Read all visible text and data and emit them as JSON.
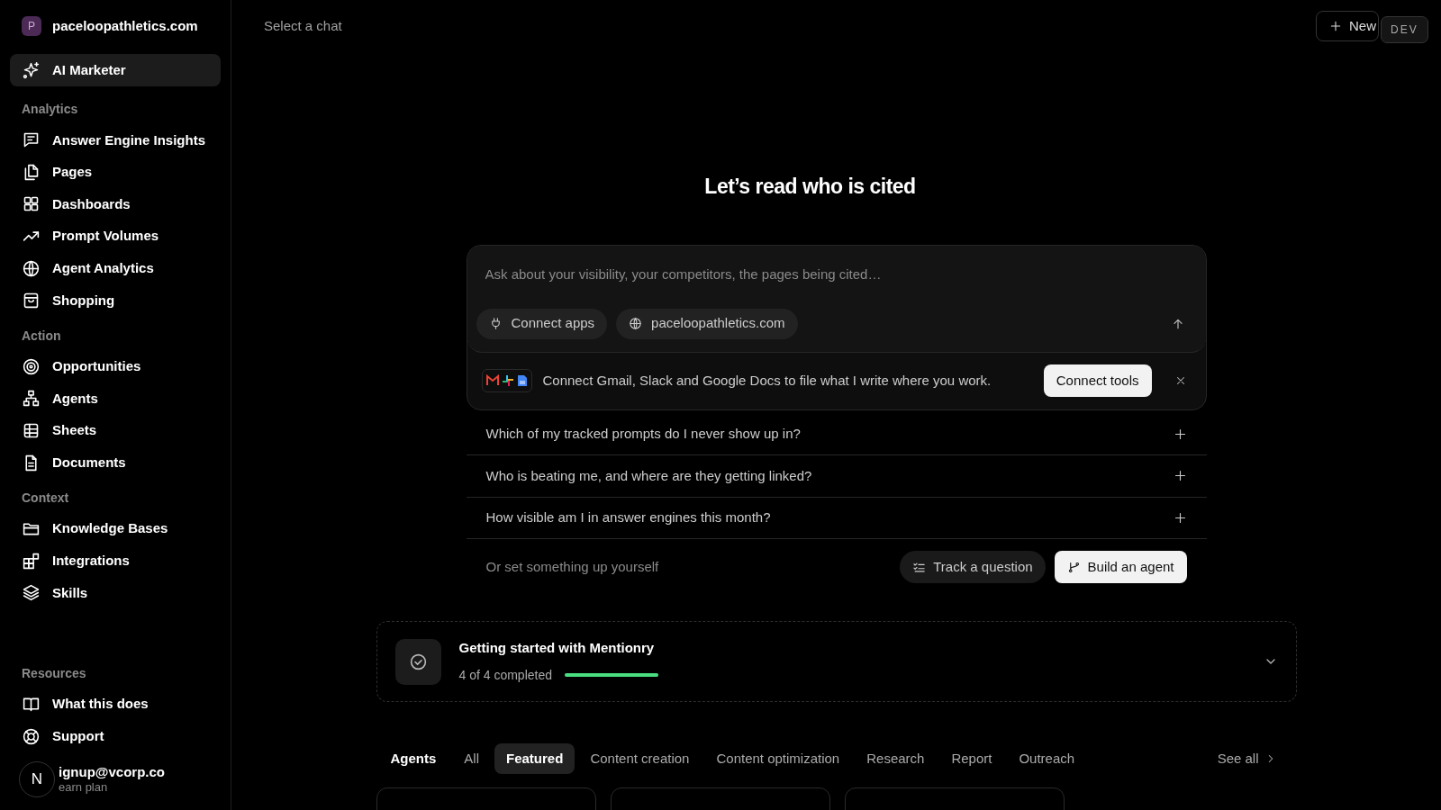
{
  "workspace": {
    "initial": "P",
    "name": "paceloopathletics.com"
  },
  "sidebar": {
    "sections": [
      {
        "items": [
          {
            "label": "AI Marketer",
            "selected": true
          }
        ]
      },
      {
        "title": "Analytics",
        "items": [
          {
            "label": "Answer Engine Insights",
            "selected": false
          },
          {
            "label": "Pages",
            "selected": false
          },
          {
            "label": "Dashboards",
            "selected": false
          },
          {
            "label": "Prompt Volumes",
            "selected": false
          },
          {
            "label": "Agent Analytics",
            "selected": false
          },
          {
            "label": "Shopping",
            "selected": false
          }
        ]
      },
      {
        "title": "Action",
        "items": [
          {
            "label": "Opportunities",
            "selected": false
          },
          {
            "label": "Agents",
            "selected": false
          },
          {
            "label": "Sheets",
            "selected": false
          },
          {
            "label": "Documents",
            "selected": false
          }
        ]
      },
      {
        "title": "Context",
        "items": [
          {
            "label": "Knowledge Bases",
            "selected": false
          },
          {
            "label": "Integrations",
            "selected": false
          },
          {
            "label": "Skills",
            "selected": false
          }
        ]
      },
      {
        "title": "Resources",
        "items": [
          {
            "label": "What this does",
            "selected": false
          },
          {
            "label": "Support",
            "selected": false
          }
        ]
      }
    ],
    "user": {
      "initial": "N",
      "email": "ignup@vcorp.co",
      "plan": "earn plan"
    }
  },
  "header": {
    "title": "Select a chat",
    "new_button": "New",
    "badge": "DEV"
  },
  "heading": "Let’s read who is cited",
  "composer": {
    "placeholder": "Ask about your visibility, your competitors, the pages being cited…",
    "chips": [
      "Connect apps",
      "paceloopathletics.com"
    ]
  },
  "connect_banner": {
    "text": "Connect Gmail, Slack and Google Docs to file what I write where you work.",
    "button": "Connect tools"
  },
  "suggestions": [
    "Which of my tracked prompts do I never show up in?",
    "Who is beating me, and where are they getting linked?",
    "How visible am I in answer engines this month?"
  ],
  "setup": {
    "text": "Or set something up yourself",
    "buttons": [
      "Track a question",
      "Build an agent"
    ]
  },
  "getting_started": {
    "title": "Getting started with Mentionry",
    "progress": "4 of 4 completed",
    "level": 1
  },
  "agents": {
    "label": "Agents",
    "tabs": [
      {
        "label": "All",
        "selected": false
      },
      {
        "label": "Featured",
        "selected": true
      },
      {
        "label": "Content creation",
        "selected": false
      },
      {
        "label": "Content optimization",
        "selected": false
      },
      {
        "label": "Research",
        "selected": false
      },
      {
        "label": "Report",
        "selected": false
      },
      {
        "label": "Outreach",
        "selected": false
      }
    ],
    "see_all": "See all",
    "cards": [
      {
        "kind": "card"
      },
      {
        "kind": "card"
      },
      {
        "kind": "card"
      }
    ]
  }
}
